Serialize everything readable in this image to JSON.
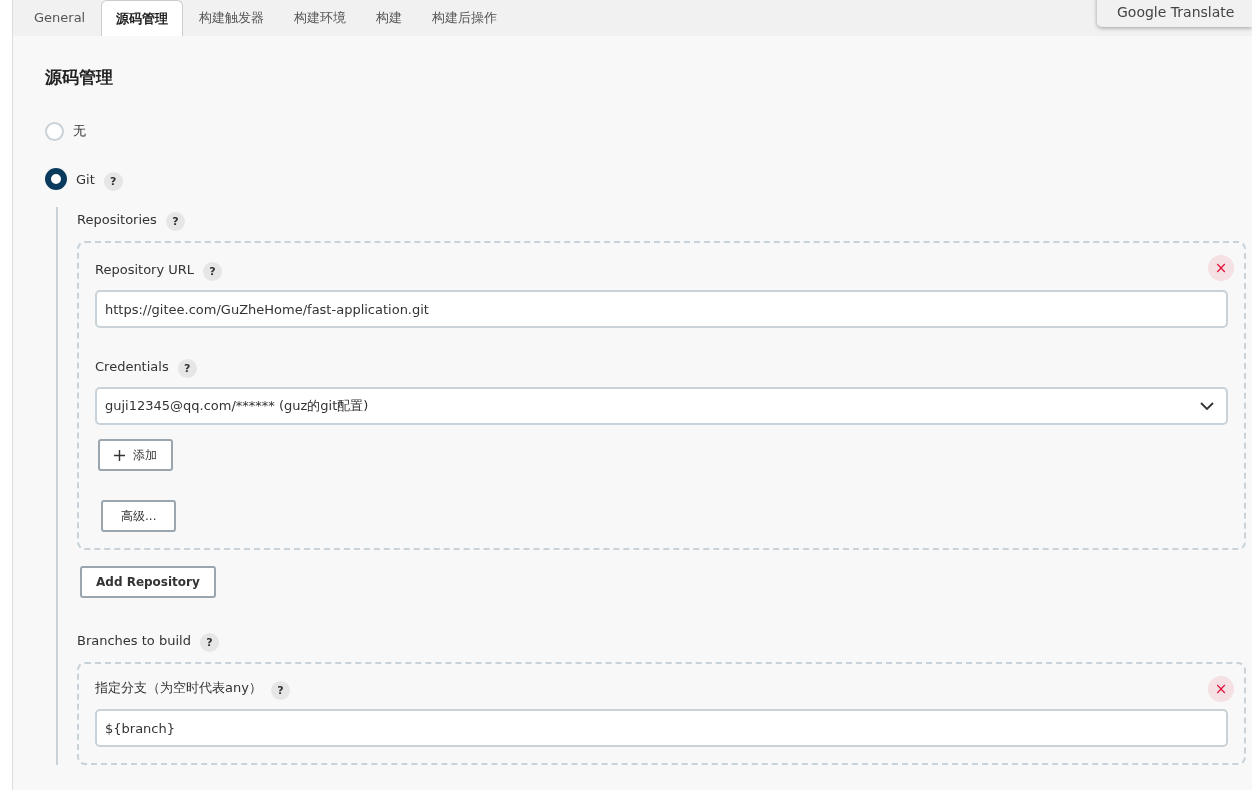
{
  "tabs": [
    {
      "label": "General",
      "selected": false
    },
    {
      "label": "源码管理",
      "selected": true
    },
    {
      "label": "构建触发器",
      "selected": false
    },
    {
      "label": "构建环境",
      "selected": false
    },
    {
      "label": "构建",
      "selected": false
    },
    {
      "label": "构建后操作",
      "selected": false
    }
  ],
  "translate_popup": {
    "label": "Google Translate"
  },
  "section": {
    "title": "源码管理"
  },
  "scm_options": [
    {
      "label": "无",
      "selected": false
    },
    {
      "label": "Git",
      "selected": true,
      "help": "?"
    }
  ],
  "git": {
    "repositories": {
      "label": "Repositories",
      "help": "?",
      "items": [
        {
          "url_label": "Repository URL",
          "url_help": "?",
          "url": "https://gitee.com/GuZheHome/fast-application.git",
          "credentials_label": "Credentials",
          "credentials_help": "?",
          "credentials": "guji12345@qq.com/****** (guz的git配置)",
          "add_button": "添加",
          "advanced_button": "高级...",
          "close": "×"
        }
      ],
      "add_button": "Add Repository"
    },
    "branches": {
      "label": "Branches to build",
      "help": "?",
      "items": [
        {
          "label": "指定分支（为空时代表any）",
          "help": "?",
          "value": "${branch}",
          "close": "×"
        }
      ]
    }
  }
}
